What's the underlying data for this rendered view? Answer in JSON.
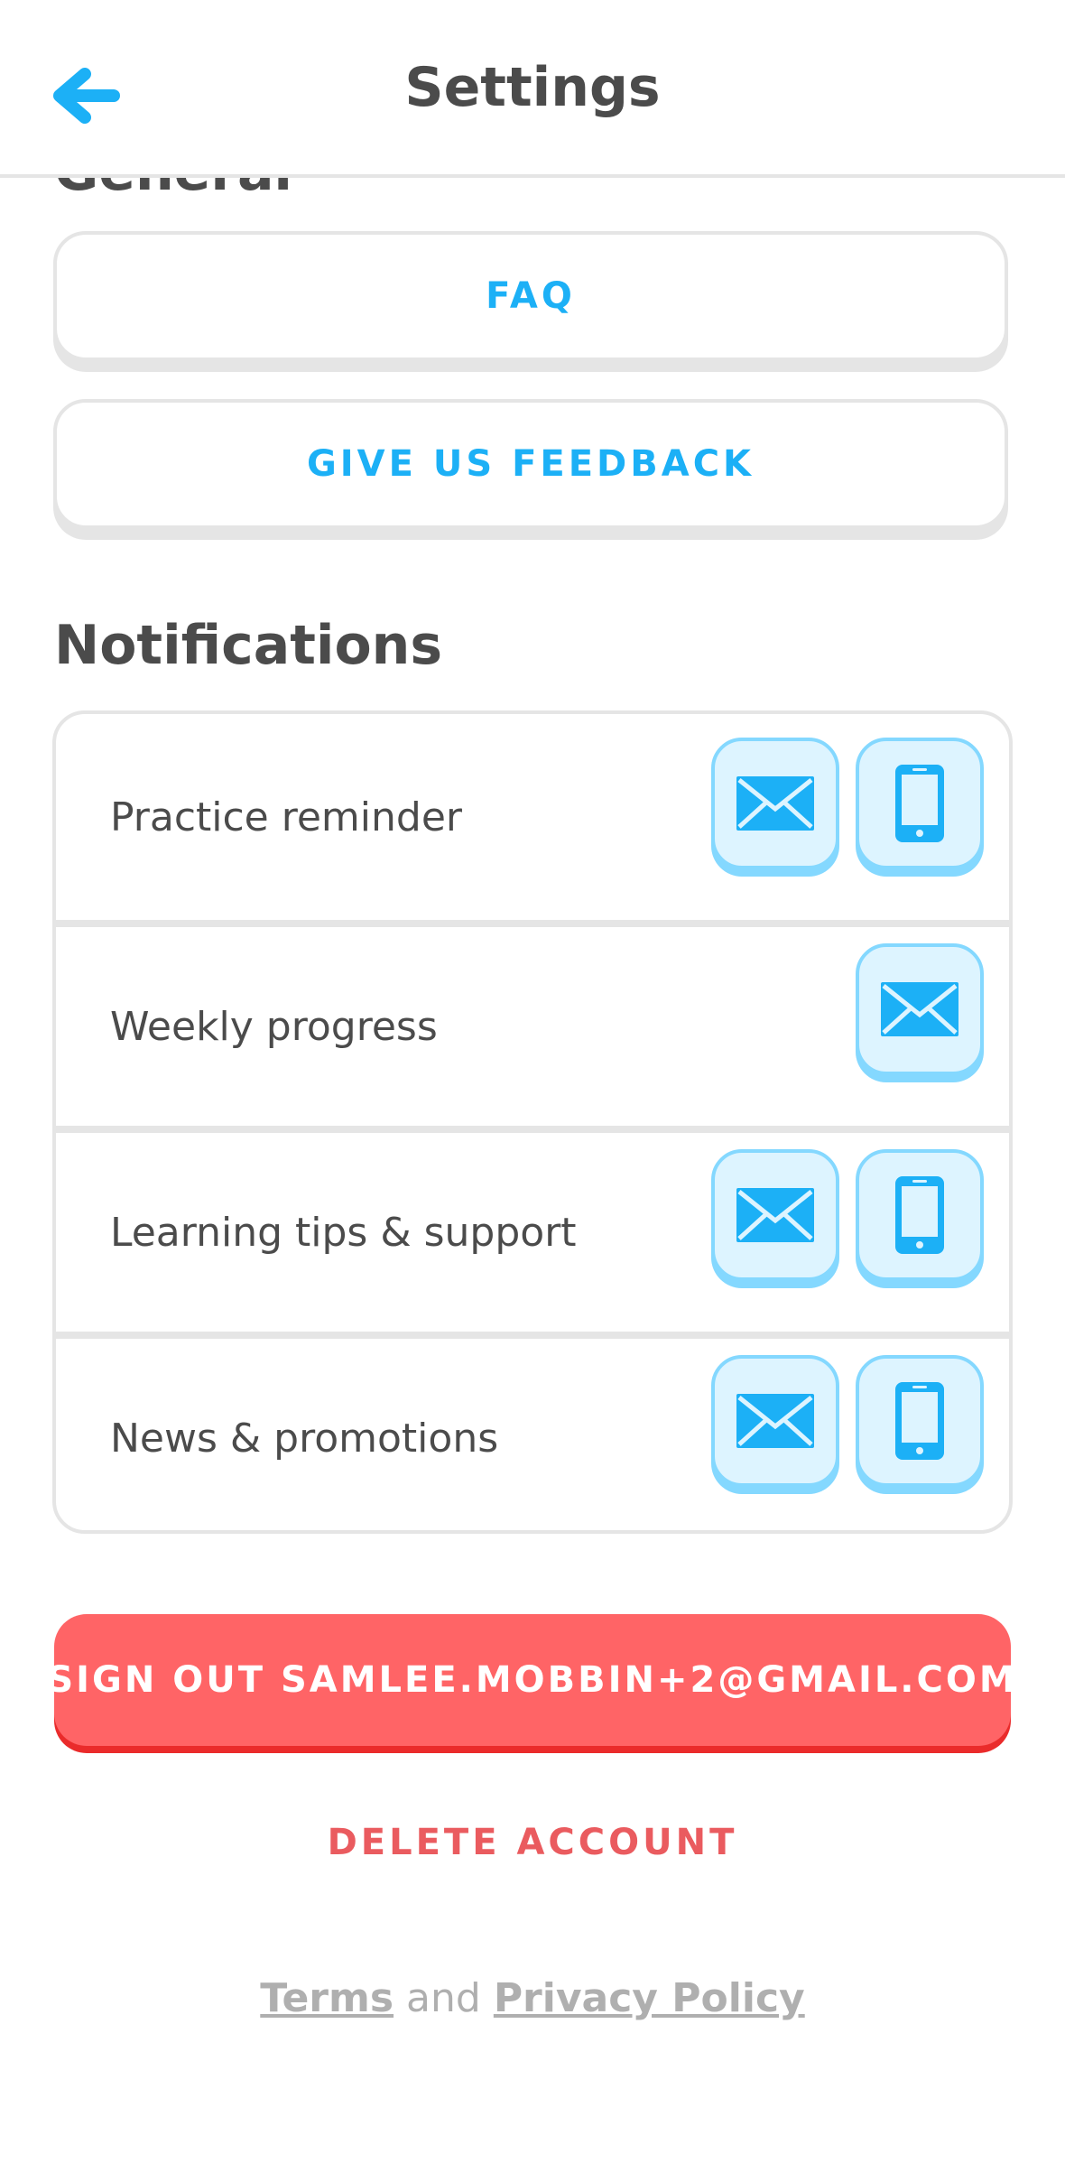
{
  "header": {
    "title": "Settings",
    "back_icon": "arrow-left-icon",
    "accent_color": "#1cb0f6"
  },
  "general": {
    "section_title": "General",
    "faq_label": "FAQ",
    "feedback_label": "GIVE US FEEDBACK"
  },
  "notifications": {
    "section_title": "Notifications",
    "rows": [
      {
        "label": "Practice reminder",
        "email": true,
        "push": true
      },
      {
        "label": "Weekly progress",
        "email": true,
        "push": false
      },
      {
        "label": "Learning tips & support",
        "email": true,
        "push": true
      },
      {
        "label": "News & promotions",
        "email": true,
        "push": true
      }
    ],
    "icons": {
      "email": "mail-icon",
      "push": "phone-icon"
    }
  },
  "account": {
    "signout_label": "SIGN OUT SAMLEE.MOBBIN+2@GMAIL.COM",
    "delete_label": "DELETE ACCOUNT",
    "signout_color": "#ff6466"
  },
  "legal": {
    "terms": "Terms",
    "and": "and",
    "privacy": "Privacy Policy"
  }
}
